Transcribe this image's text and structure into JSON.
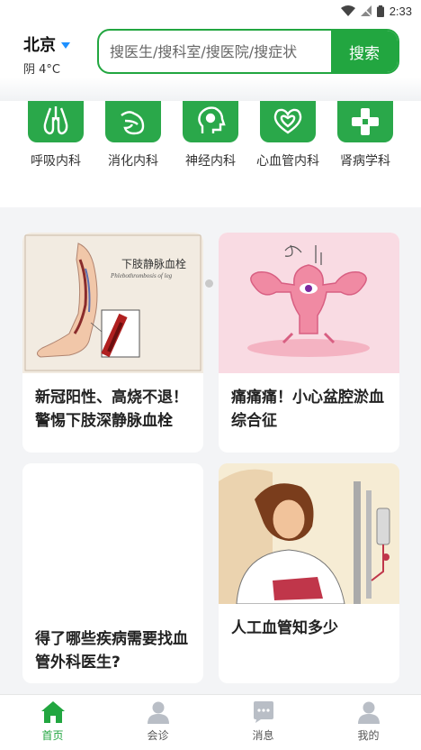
{
  "status_bar": {
    "time": "2:33"
  },
  "header": {
    "city": "北京",
    "weather": "阴 4°C",
    "search_placeholder": "搜医生/搜科室/搜医院/搜症状",
    "search_button": "搜索"
  },
  "departments": [
    {
      "label": "呼吸内科",
      "icon": "lungs-icon"
    },
    {
      "label": "消化内科",
      "icon": "stomach-icon"
    },
    {
      "label": "神经内科",
      "icon": "brain-icon"
    },
    {
      "label": "心血管内科",
      "icon": "heart-icon"
    },
    {
      "label": "肾病学科",
      "icon": "kidney-icon"
    }
  ],
  "carousel": {
    "pages": 5,
    "active": 1
  },
  "articles": [
    {
      "title": "新冠阳性、高烧不退！警惕下肢深静脉血栓",
      "image_caption": "下肢静脉血栓",
      "image_subcaption": "Phlebothrombosis of leg"
    },
    {
      "title": "痛痛痛！小心盆腔淤血综合征"
    },
    {
      "title": "得了哪些疾病需要找血管外科医生?"
    },
    {
      "title": "人工血管知多少"
    }
  ],
  "tabs": [
    {
      "label": "首页",
      "icon": "home-icon",
      "active": true
    },
    {
      "label": "会诊",
      "icon": "person-icon",
      "active": false
    },
    {
      "label": "消息",
      "icon": "message-icon",
      "active": false
    },
    {
      "label": "我的",
      "icon": "profile-icon",
      "active": false
    }
  ],
  "colors": {
    "primary": "#22a640",
    "accent": "#1e90ff",
    "background": "#f3f4f6"
  }
}
